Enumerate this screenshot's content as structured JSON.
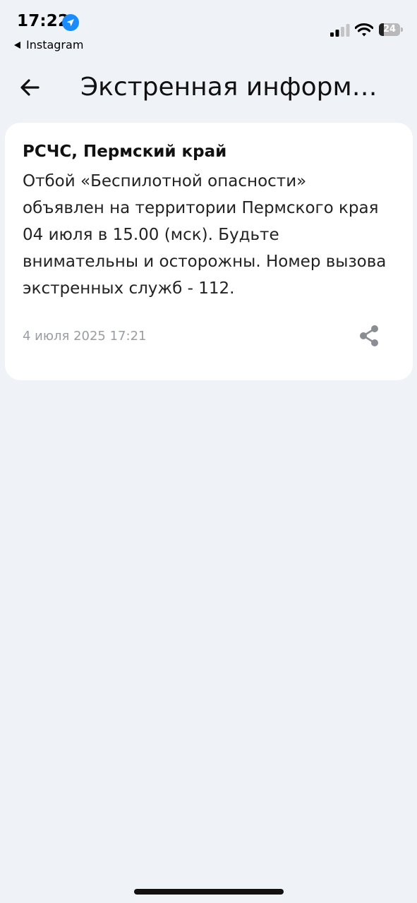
{
  "status_bar": {
    "time": "17:22",
    "back_app": "Instagram",
    "battery": {
      "level": "24",
      "fraction": 0.24
    }
  },
  "header": {
    "title": "Экстренная информа..."
  },
  "alert": {
    "sender": "РСЧС, Пермский край",
    "message": "Отбой «Беспилотной опасности» объявлен на территории Пермского края 04 июля в 15.00 (мск). Будьте внимательны и осторожны. Номер вызова экстренных служб - 112.",
    "date": "4 июля 2025 17:21"
  },
  "icons": {
    "location": "location-arrow-icon",
    "back": "arrow-left-icon",
    "share": "share-icon",
    "signal": "cellular-signal-icon",
    "wifi": "wifi-icon"
  },
  "colors": {
    "background": "#eff2f7",
    "card": "#ffffff",
    "accent_blue": "#1a8cff",
    "date_gray": "#9a9da3"
  }
}
